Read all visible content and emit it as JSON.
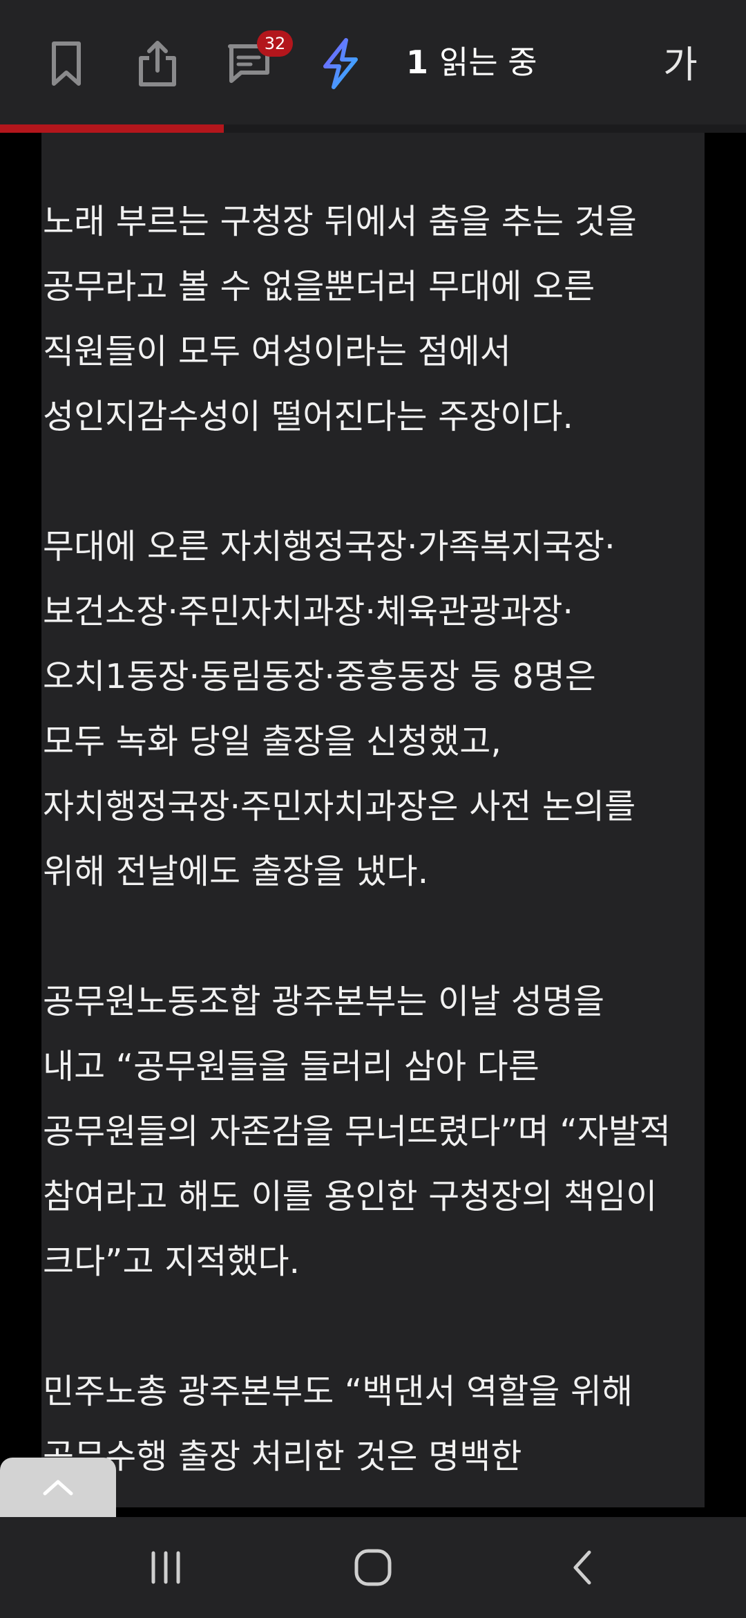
{
  "toolbar": {
    "comment_count": "32",
    "reading_count": "1",
    "reading_label": "읽는 중",
    "font_size_label": "가",
    "accent_color": "#b3161c",
    "progress": 0.3
  },
  "article": {
    "paragraphs": [
      {
        "lines": [
          "노래 부르는 구청장 뒤에서 춤을 추는 것을",
          "공무라고 볼 수 없을뿐더러 무대에 오른",
          "직원들이 모두 여성이라는 점에서",
          "성인지감수성이 떨어진다는 주장이다."
        ]
      },
      {
        "lines": [
          "무대에 오른 자치행정국장·가족복지국장·",
          "보건소장·주민자치과장·체육관광과장·",
          "오치1동장·동림동장·중흥동장 등 8명은",
          "모두 녹화 당일 출장을 신청했고,",
          "자치행정국장·주민자치과장은 사전 논의를",
          "위해 전날에도 출장을 냈다."
        ]
      },
      {
        "lines": [
          "공무원노동조합 광주본부는 이날 성명을",
          "내고 “공무원들을 들러리 삼아 다른",
          "공무원들의 자존감을 무너뜨렸다”며 “자발적",
          "참여라고 해도 이를 용인한 구청장의 책임이",
          "크다”고 지적했다."
        ]
      },
      {
        "lines": [
          "민주노총 광주본부도 “백댄서 역할을 위해",
          "공무수행 출장 처리한 것은 명백한"
        ]
      }
    ]
  },
  "icons": {
    "bookmark": "bookmark-icon",
    "share": "share-icon",
    "comment": "comment-icon",
    "lightning": "lightning-icon",
    "scroll_top": "chevron-up-icon",
    "nav_recents": "recent-apps-icon",
    "nav_home": "home-icon",
    "nav_back": "back-icon"
  }
}
